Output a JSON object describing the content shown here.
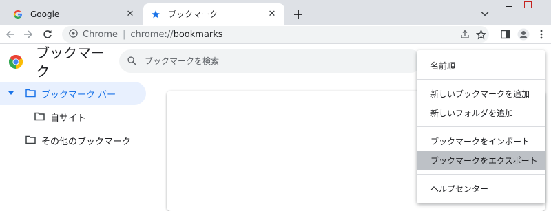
{
  "tabs": [
    {
      "title": "Google",
      "favicon": "google-g-icon",
      "active": false
    },
    {
      "title": "ブックマーク",
      "favicon": "star-icon",
      "active": true
    }
  ],
  "toolbar": {
    "omnibox_chip": "Chrome",
    "omnibox_separator": "|",
    "url_scheme": "chrome://",
    "url_host": "bookmarks"
  },
  "page": {
    "title": "ブックマーク",
    "search_placeholder": "ブックマークを検索"
  },
  "sidebar": {
    "items": [
      {
        "label": "ブックマーク バー",
        "selected": true,
        "expanded": true
      },
      {
        "label": "自サイト",
        "selected": false
      },
      {
        "label": "その他のブックマーク",
        "selected": false
      }
    ]
  },
  "menu": {
    "sort": "名前順",
    "add_bookmark": "新しいブックマークを追加",
    "add_folder": "新しいフォルダを追加",
    "import": "ブックマークをインポート",
    "export": "ブックマークをエクスポート",
    "help": "ヘルプセンター"
  },
  "colors": {
    "accent": "#1a73e8",
    "selected_bg": "#e8f0fe",
    "tabstrip_bg": "#dee1e6",
    "menu_highlight": "#bdc1c6",
    "window_close": "#c5221f"
  }
}
